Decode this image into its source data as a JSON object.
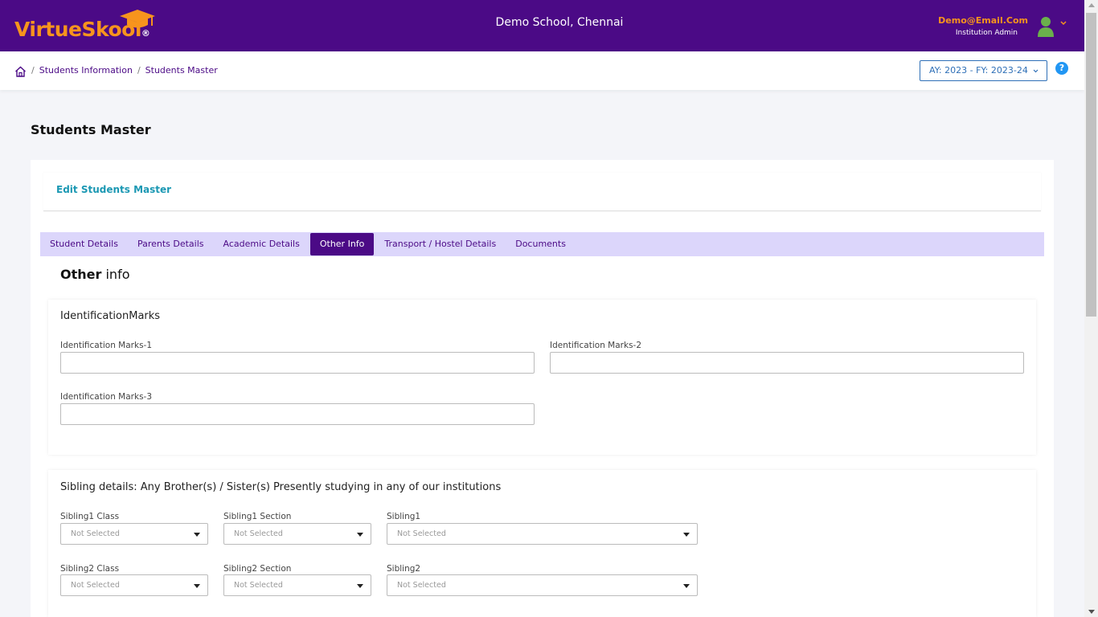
{
  "header": {
    "logo_part1": "Virtue",
    "logo_part2": "Skool",
    "logo_mark": "®",
    "school_name": "Demo School, Chennai",
    "user_email": "Demo@Email.Com",
    "user_role": "Institution Admin"
  },
  "breadcrumb": {
    "items": [
      "Students Information",
      "Students Master"
    ],
    "separator": "/"
  },
  "year_selector": {
    "value": "AY: 2023 - FY: 2023-24"
  },
  "help": {
    "label": "?"
  },
  "page": {
    "title": "Students Master"
  },
  "card": {
    "title": "Edit Students Master"
  },
  "tabs": [
    {
      "label": "Student Details"
    },
    {
      "label": "Parents Details"
    },
    {
      "label": "Academic Details"
    },
    {
      "label": "Other Info",
      "active": true
    },
    {
      "label": "Transport / Hostel Details"
    },
    {
      "label": "Documents"
    }
  ],
  "other_info": {
    "title_bold": "Other",
    "title_rest": " info"
  },
  "identification": {
    "title": "IdentificationMarks",
    "fields": [
      {
        "label": "Identification Marks-1",
        "value": ""
      },
      {
        "label": "Identification Marks-2",
        "value": ""
      },
      {
        "label": "Identification Marks-3",
        "value": ""
      }
    ]
  },
  "siblings": {
    "title": "Sibling details: Any Brother(s) / Sister(s) Presently studying in any of our institutions",
    "row1": [
      {
        "label": "Sibling1 Class",
        "value": "Not Selected"
      },
      {
        "label": "Sibling1 Section",
        "value": "Not Selected"
      },
      {
        "label": "Sibling1",
        "value": "Not Selected"
      }
    ],
    "row2": [
      {
        "label": "Sibling2 Class",
        "value": "Not Selected"
      },
      {
        "label": "Sibling2 Section",
        "value": "Not Selected"
      },
      {
        "label": "Sibling2",
        "value": "Not Selected"
      }
    ]
  },
  "colors": {
    "brand_purple": "#4b0a86",
    "brand_orange": "#f7941d",
    "tab_bar": "#dcd6fb",
    "card_title": "#1b98b3",
    "year_select": "#2e6fb7",
    "help": "#2196f3",
    "avatar": "#6ab04c"
  }
}
